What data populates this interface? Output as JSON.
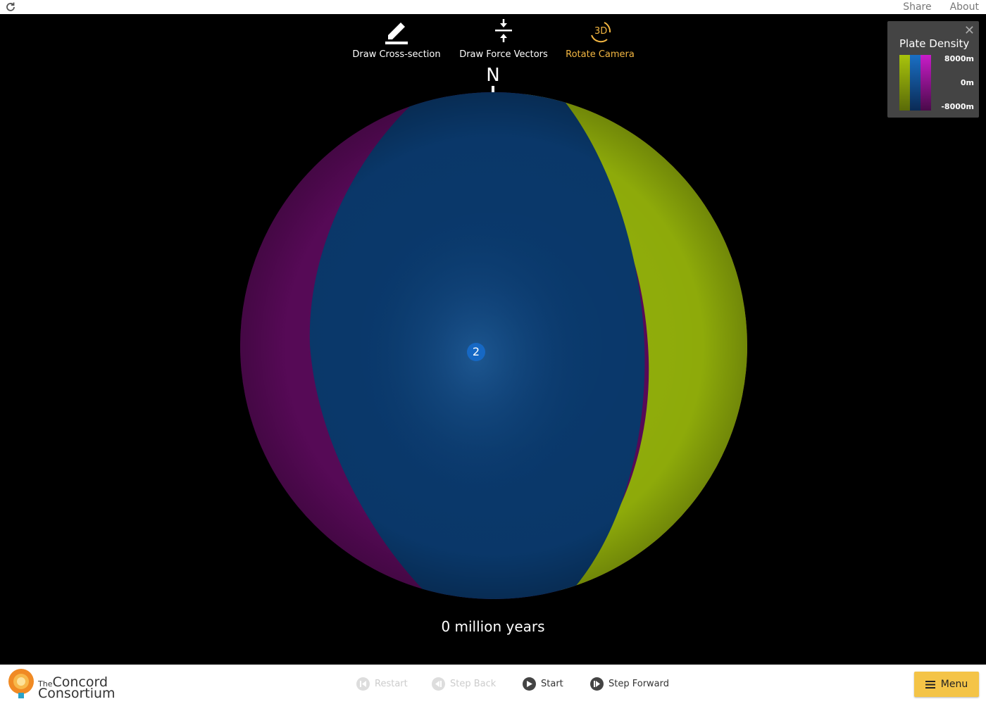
{
  "topbar": {
    "share": "Share",
    "about": "About"
  },
  "toolbar": {
    "cross_section": "Draw Cross-section",
    "force_vectors": "Draw Force Vectors",
    "rotate_camera": "Rotate Camera",
    "rotate_icon_text": "3D"
  },
  "globe": {
    "north_label": "N",
    "plate_badge": "2",
    "plate_colors": {
      "left": "#5a0a5a",
      "center": "#0a3a6e",
      "right": "#95b30b"
    }
  },
  "time": {
    "label": "0 million years"
  },
  "legend": {
    "title": "Plate Density",
    "max": "8000m",
    "mid": "0m",
    "min": "-8000m",
    "colors": [
      "#a9c40c",
      "#1a5ea8",
      "#a81ca8"
    ]
  },
  "controls": {
    "restart": "Restart",
    "step_back": "Step Back",
    "start": "Start",
    "step_forward": "Step Forward",
    "menu": "Menu"
  },
  "logo": {
    "line1_small": "The",
    "line1": "Concord",
    "line2": "Consortium"
  }
}
